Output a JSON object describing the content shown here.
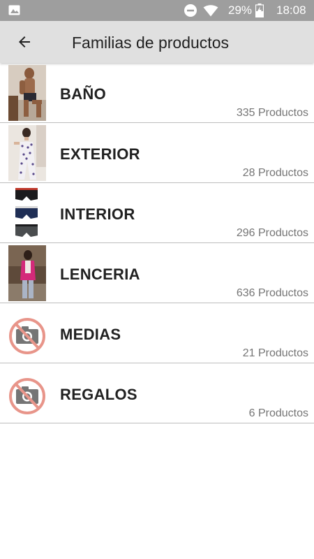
{
  "status_bar": {
    "battery_percent": "29%",
    "time": "18:08"
  },
  "app_bar": {
    "title": "Familias de productos"
  },
  "families": [
    {
      "name": "BAÑO",
      "count": "335 Productos",
      "image": "photo-man-swimwear"
    },
    {
      "name": "EXTERIOR",
      "count": "28 Productos",
      "image": "photo-woman-jumpsuit"
    },
    {
      "name": "INTERIOR",
      "count": "296 Productos",
      "image": "photo-boxer-briefs"
    },
    {
      "name": "LENCERIA",
      "count": "636 Productos",
      "image": "photo-woman-pink-jacket"
    },
    {
      "name": "MEDIAS",
      "count": "21 Productos",
      "image": "no-photo-icon"
    },
    {
      "name": "REGALOS",
      "count": "6 Productos",
      "image": "no-photo-icon"
    }
  ],
  "colors": {
    "status_bar": "#9e9e9e",
    "app_bar": "#e0e0e0",
    "divider": "#bdbdbd",
    "no_photo_accent": "#e8958a"
  }
}
